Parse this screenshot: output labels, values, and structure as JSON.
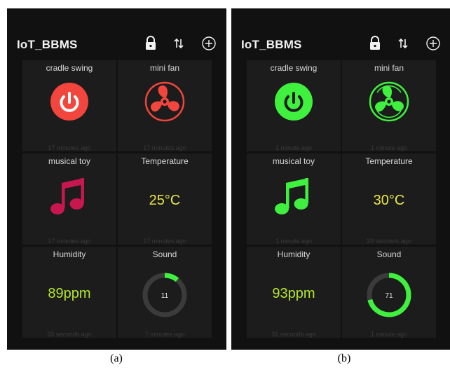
{
  "panels": [
    {
      "app_title": "IoT_BBMS",
      "caption": "(a)",
      "tiles": {
        "cradle": {
          "label": "cradle swing",
          "footer": "17 minutes ago",
          "color": "#f2453d"
        },
        "fan": {
          "label": "mini fan",
          "footer": "17 minutes ago",
          "color": "#f2453d"
        },
        "toy": {
          "label": "musical toy",
          "footer": "17 minutes ago",
          "color": "#c8174f"
        },
        "temperature": {
          "label": "Temperature",
          "value": "25°C",
          "footer": "17 minutes ago",
          "color": "#e8e64a"
        },
        "humidity": {
          "label": "Humidity",
          "value": "89ppm",
          "footer": "33 seconds ago",
          "color": "#b4e62d"
        },
        "sound": {
          "label": "Sound",
          "value": "11",
          "level_percent": 11,
          "footer": "7 minutes ago",
          "color": "#3ff03f"
        }
      }
    },
    {
      "app_title": "IoT_BBMS",
      "caption": "(b)",
      "tiles": {
        "cradle": {
          "label": "cradle swing",
          "footer": "1 minute ago",
          "color": "#3ff03f"
        },
        "fan": {
          "label": "mini fan",
          "footer": "1 minute ago",
          "color": "#3ff03f"
        },
        "toy": {
          "label": "musical toy",
          "footer": "1 minute ago",
          "color": "#3ff03f"
        },
        "temperature": {
          "label": "Temperature",
          "value": "30°C",
          "footer": "29 seconds ago",
          "color": "#e8e64a"
        },
        "humidity": {
          "label": "Humidity",
          "value": "93ppm",
          "footer": "31 seconds ago",
          "color": "#b4e62d"
        },
        "sound": {
          "label": "Sound",
          "value": "71",
          "level_percent": 71,
          "footer": "1 minute ago",
          "color": "#3ff03f"
        }
      }
    }
  ],
  "icons": {
    "lock": "lock-icon",
    "sync": "sync-arrows-icon",
    "add": "add-circle-icon",
    "power": "power-icon",
    "fan": "fan-icon",
    "music": "music-note-icon"
  },
  "gauge_track_color": "#3b3b3b"
}
